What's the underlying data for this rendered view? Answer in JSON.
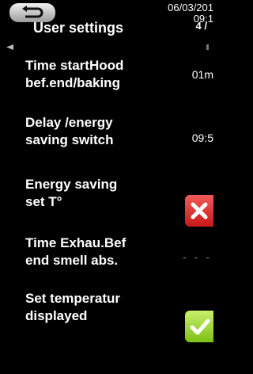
{
  "header": {
    "date": "06/03/201",
    "time": "09:1",
    "title": "User settings",
    "page": "4 /"
  },
  "settings": [
    {
      "label_line1": "Time startHood",
      "label_line2": "bef.end/baking",
      "value": "01m"
    },
    {
      "label_line1": "Delay /energy",
      "label_line2": "saving switch",
      "value": "09:5"
    },
    {
      "label_line1": "Energy saving",
      "label_line2": "set T°",
      "state": "off"
    },
    {
      "label_line1": "Time Exhau.Bef",
      "label_line2": "end smell abs.",
      "value": "- - -"
    },
    {
      "label_line1": "Set temperatur",
      "label_line2": "displayed",
      "state": "on"
    }
  ],
  "colors": {
    "background": "#000000",
    "toggle_off": "#e23030",
    "toggle_on": "#9fd83a"
  }
}
